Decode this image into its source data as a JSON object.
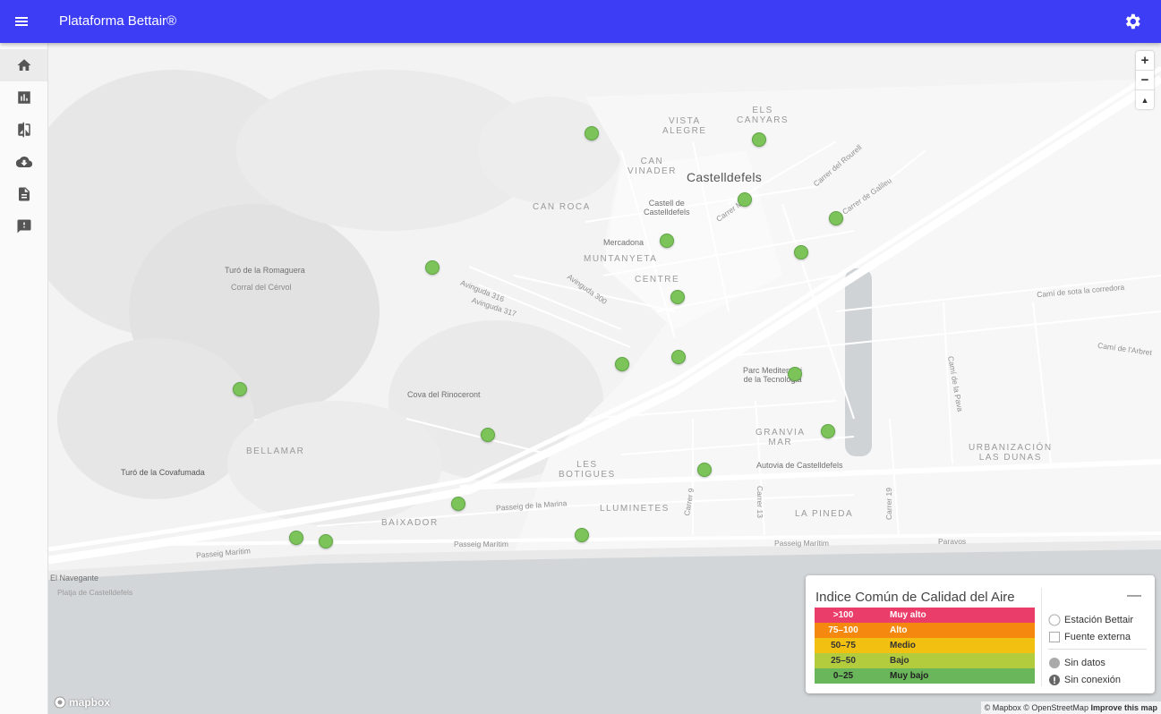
{
  "app": {
    "title": "Plataforma Bettair®"
  },
  "icons": {
    "menu": "menu-icon",
    "settings": "gear-icon",
    "nav": [
      "home-icon",
      "bar-chart-icon",
      "compare-icon",
      "cloud-download-icon",
      "document-icon",
      "feedback-icon"
    ]
  },
  "colors": {
    "appbar": "#3d3df5",
    "station": "#7cc35a",
    "aq_muy_alto": "#eb3d6a",
    "aq_alto": "#f5880f",
    "aq_medio": "#f2c010",
    "aq_bajo": "#b2cc3d",
    "aq_muy_bajo": "#6ab65a"
  },
  "map": {
    "labels": {
      "city": "Castelldefels",
      "vista_alegre": "VISTA\nALEGRE",
      "els_canyars": "ELS\nCANYARS",
      "can_vinader": "CAN\nVINADER",
      "can_roca": "CAN ROCA",
      "castell": "Castell de\nCastelldefels",
      "mercadona": "Mercadona",
      "muntanyeta": "MUNTANYETA",
      "centre": "CENTRE",
      "turo_romaguera": "Turó de la Romaguera",
      "corral_cervol": "Corral del Cérvol",
      "av316": "Avinguda 316",
      "av317": "Avinguda 317",
      "av300": "Avinguda 300",
      "carrer_rourell": "Carrer del Rourell",
      "carrer_galileu": "Carrer de Galileu",
      "carrer_m": "Carrer M",
      "cami_corredora": "Camí de sota la corredora",
      "cami_arbret": "Camí de l'Arbret",
      "cami_pava": "Camí de la Pava",
      "parc_med": "Parc Mediterrani\nde la Tecnologia",
      "cova": "Cova del Rinoceront",
      "granvia": "GRANVIA\nMAR",
      "urbanizacion": "URBANIZACIÓN\nLAS DUNAS",
      "bellamar": "BELLAMAR",
      "les_botigues": "LES\nBOTIGUES",
      "autovia": "Autovia de Castelldefels",
      "turo_covafumada": "Turó de la Covafumada",
      "carrer9": "Carrer 9",
      "carrer13": "Carrer 13",
      "carrer19": "Carrer 19",
      "passeig_marina": "Passeig de la Marina",
      "lluminetes": "LLUMINETES",
      "la_pineda": "LA PINEDA",
      "baixador": "BAIXADOR",
      "passeig_maritim_1": "Passeig Marítim",
      "passeig_maritim_2": "Passeig Marítim",
      "passeig_maritim_3": "Passeig Marítim",
      "paravos": "Paravos",
      "el_navegante": "El Navegante",
      "platja": "Platja de Castelldefels"
    },
    "zoom_in": "+",
    "zoom_out": "−",
    "compass": "▲",
    "mapbox_logo": "mapbox",
    "attribution": "© Mapbox © OpenStreetMap",
    "improve": "Improve this map"
  },
  "legend": {
    "title": "Indice Común de Calidad del Aire",
    "collapse": "—",
    "levels": [
      {
        "range": ">100",
        "label": "Muy alto"
      },
      {
        "range": "75–100",
        "label": "Alto"
      },
      {
        "range": "50–75",
        "label": "Medio"
      },
      {
        "range": "25–50",
        "label": "Bajo"
      },
      {
        "range": "0–25",
        "label": "Muy bajo"
      }
    ],
    "keys": {
      "station": "Estación Bettair",
      "external": "Fuente externa",
      "no_data": "Sin datos",
      "offline": "Sin conexión"
    }
  }
}
